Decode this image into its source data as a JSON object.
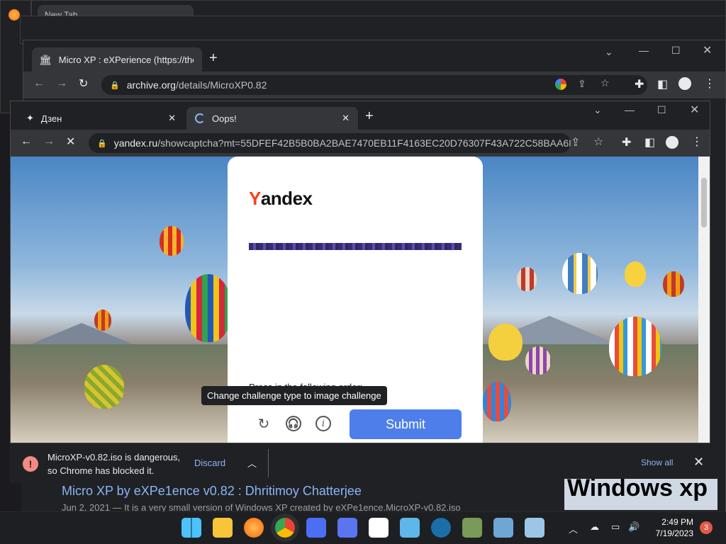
{
  "background_window": {
    "tab_label": "New Tab"
  },
  "archive_window": {
    "tab_title": "Micro XP : eXPerience (https://the",
    "url_host": "archive.org",
    "url_path": "/details/MicroXP0.82"
  },
  "yandex_window": {
    "tabs": [
      {
        "label": "Дзен",
        "active": false
      },
      {
        "label": "Oops!",
        "active": true
      }
    ],
    "url_host": "yandex.ru",
    "url_path": "/showcaptcha?mt=55DFEF42B5B0BA2BAE7470EB11F4163EC20D76307F43A722C58BAA6D0...",
    "captcha": {
      "logo_first": "Y",
      "logo_rest": "andex",
      "instruction": "Press in the following order:",
      "tooltip": "Change challenge type to image challenge",
      "submit_label": "Submit"
    }
  },
  "download_bar": {
    "line1": "MicroXP-v0.82.iso is dangerous,",
    "line2": "so Chrome has blocked it.",
    "discard_label": "Discard",
    "show_all_label": "Show all"
  },
  "search_result": {
    "title": "Micro XP by eXPe1ence v0.82 : Dhritimoy Chatterjee",
    "description": "Jun 2, 2021 — It is a very small version of Windows XP created by eXPe1ence.MicroXP-v0.82.iso",
    "thumb_text": "Windows xp"
  },
  "taskbar": {
    "time": "2:49 PM",
    "date": "7/19/2023",
    "notification_count": "3"
  }
}
